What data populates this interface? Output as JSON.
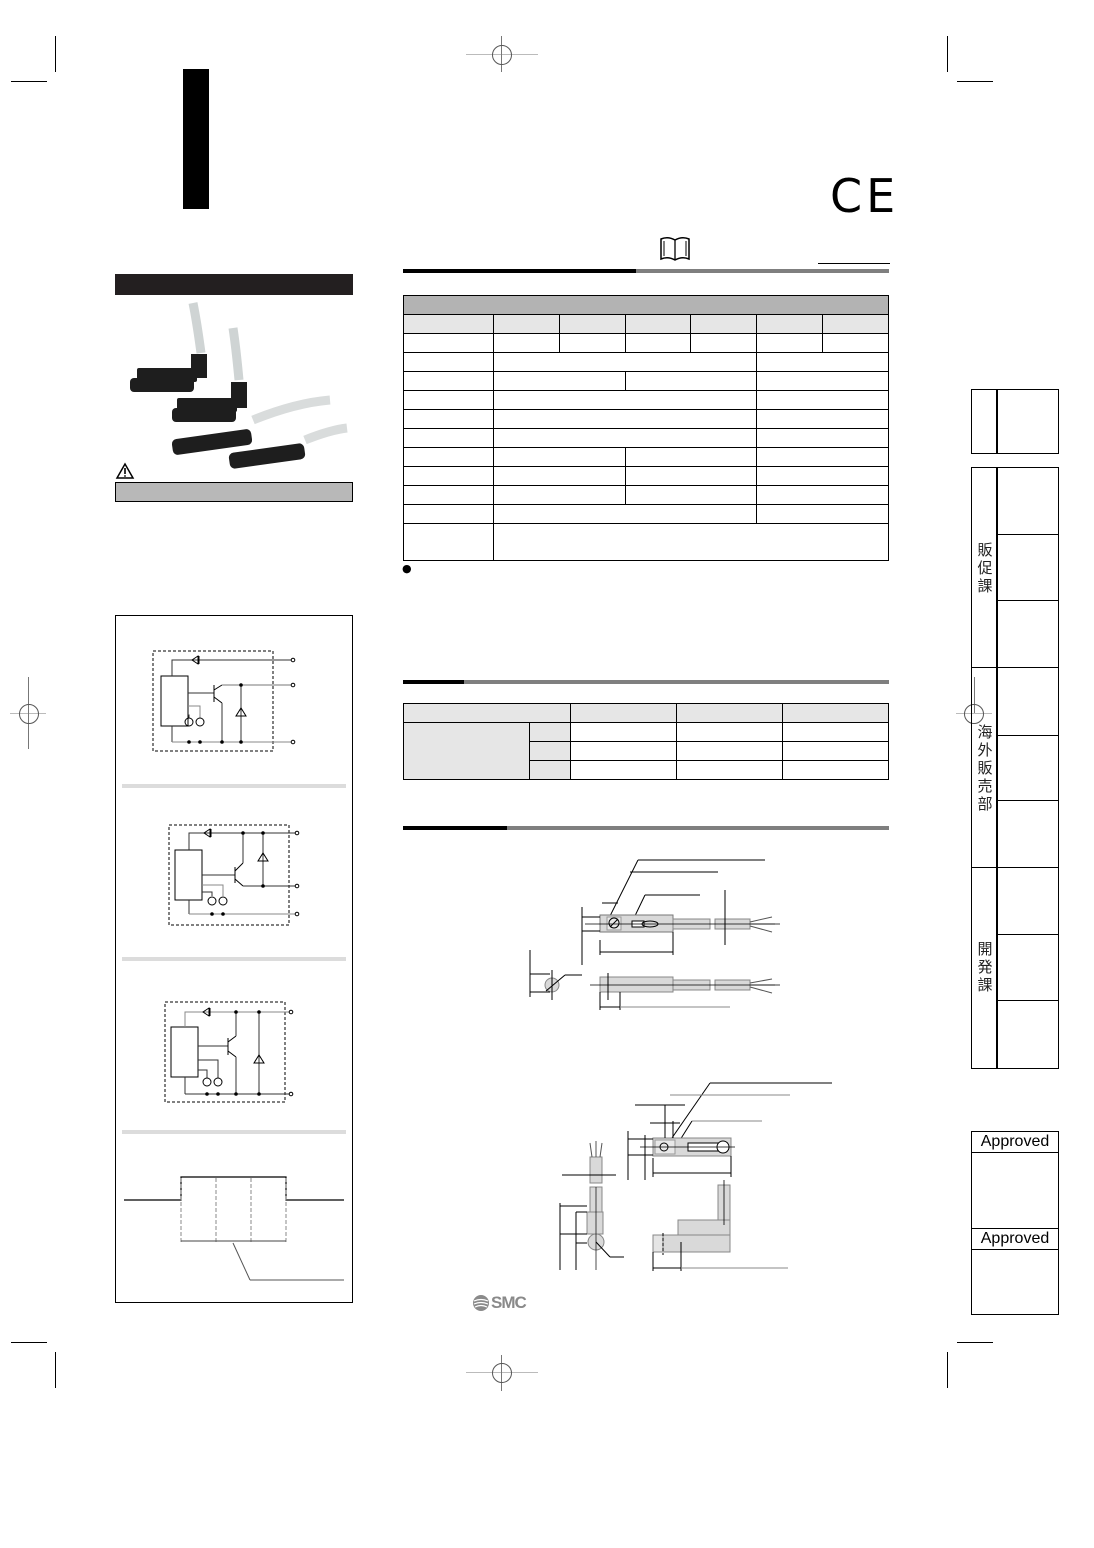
{
  "page": {
    "type": "product catalog page",
    "marks": {
      "ce_mark": "CE",
      "manual_icon": "book-icon",
      "warning_icon": "warning-triangle-icon"
    },
    "brand": {
      "logo_text": "SMC"
    },
    "spec_table": {
      "rows": 12,
      "note_bullet": "●"
    },
    "side_stamp": {
      "departments": [
        {
          "label_chars": [
            "販",
            "促",
            "課"
          ]
        },
        {
          "label_chars": [
            "海",
            "外",
            "販",
            "売",
            "部"
          ]
        },
        {
          "label_chars": [
            "開",
            "発",
            "課"
          ]
        }
      ],
      "approvals": [
        {
          "label": "Approved"
        },
        {
          "label": "Approved"
        }
      ]
    },
    "colors": {
      "section_bar_dark": "#000000",
      "section_bar_light": "#7f7f7f",
      "table_header": "#b3b3b3",
      "table_subheader": "#e6e6e6",
      "logo": "#8a8a8a"
    }
  }
}
